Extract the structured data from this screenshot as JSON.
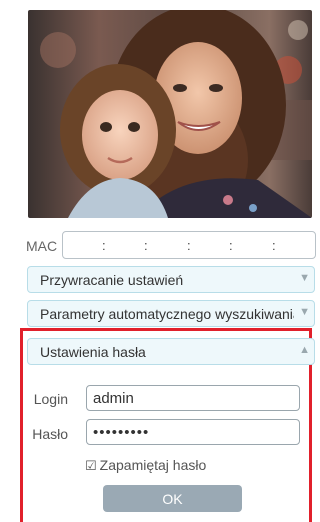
{
  "photo": {
    "alt_subject": "woman-and-child-photo"
  },
  "mac": {
    "label": "MAC",
    "separators": [
      ":",
      ":",
      ":",
      ":",
      ":"
    ]
  },
  "sections": {
    "restore": {
      "label": "Przywracanie ustawień",
      "arrow": "▼"
    },
    "auto_search": {
      "label": "Parametry automatycznego wyszukiwania",
      "arrow": "▼"
    },
    "password": {
      "label": "Ustawienia hasła",
      "arrow": "▲"
    }
  },
  "login_form": {
    "login_label": "Login",
    "login_value": "admin",
    "password_label": "Hasło",
    "password_value": "•••••••••",
    "remember_checkbox": "☑",
    "remember_label": "Zapamiętaj hasło",
    "ok_label": "OK"
  },
  "colors": {
    "accordion_bg": "#eef8fb",
    "accordion_border": "#b8dde8",
    "highlight_border": "#e1202b",
    "ok_button": "#9aa9b4"
  }
}
